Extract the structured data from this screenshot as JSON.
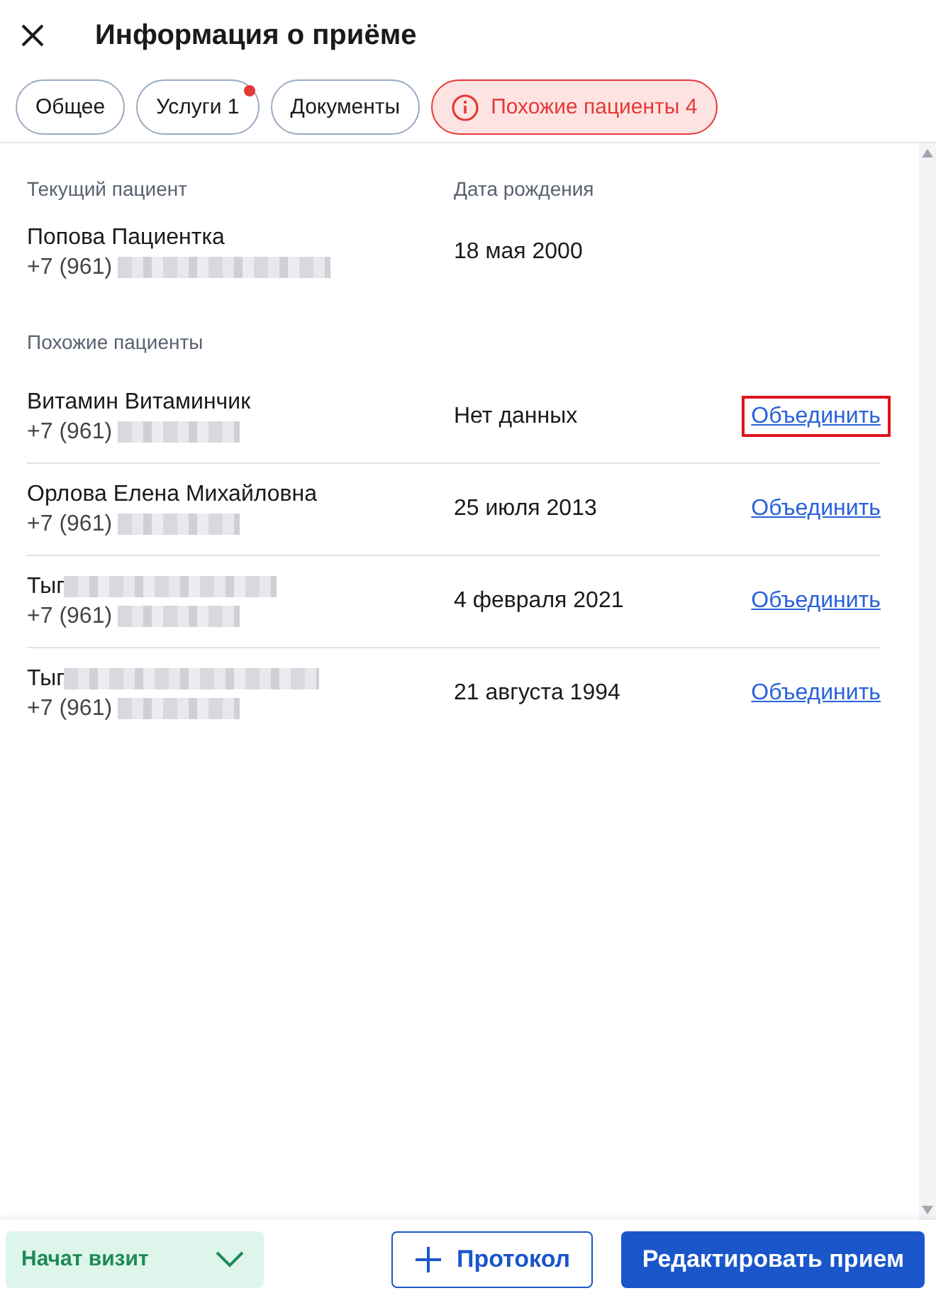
{
  "header": {
    "title": "Информация о приёме"
  },
  "tabs": [
    {
      "label": "Общее",
      "selected": false,
      "kind": "plain",
      "dot": false
    },
    {
      "label": "Услуги 1",
      "selected": false,
      "kind": "plain",
      "dot": true
    },
    {
      "label": "Документы",
      "selected": false,
      "kind": "plain",
      "dot": false
    },
    {
      "label": "Похожие пациенты 4",
      "selected": true,
      "kind": "alert",
      "dot": false
    }
  ],
  "current": {
    "heading": "Текущий пациент",
    "birth_heading": "Дата рождения",
    "name": "Попова Пациентка",
    "phone": "+7 (961)",
    "birth": "18 мая 2000"
  },
  "similar": {
    "heading": "Похожие пациенты",
    "rows": [
      {
        "name": "Витамин Витаминчик",
        "name_redacted": false,
        "phone": "+7 (961)",
        "birth": "Нет данных",
        "action": "Объединить",
        "highlighted": true
      },
      {
        "name": "Орлова Елена Михайловна",
        "name_redacted": false,
        "phone": "+7 (961)",
        "birth": "25 июля 2013",
        "action": "Объединить",
        "highlighted": false
      },
      {
        "name": "Тыг",
        "name_redacted": true,
        "phone": "+7 (961)",
        "birth": "4 февраля 2021",
        "action": "Объединить",
        "highlighted": false
      },
      {
        "name": "Тыг",
        "name_redacted": true,
        "phone": "+7 (961)",
        "birth": "21 августа 1994",
        "action": "Объединить",
        "highlighted": false
      }
    ]
  },
  "footer": {
    "status": "Начат визит",
    "protocol": "Протокол",
    "edit": "Редактировать прием"
  }
}
